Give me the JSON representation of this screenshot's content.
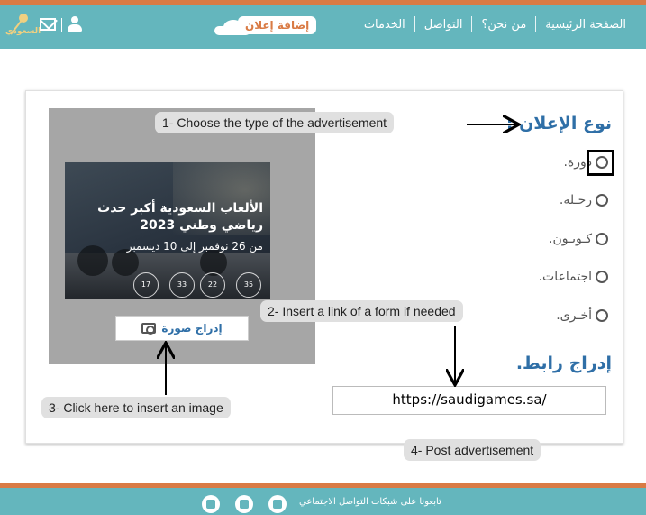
{
  "header": {
    "nav_items": [
      "الصفحة الرئيسية",
      "من نحن؟",
      "التواصل",
      "الخدمات"
    ],
    "add_ad_label": "إضافة إعلان",
    "logo_text": "السعودي"
  },
  "form": {
    "ad_type_title": "نوع الإعلان :",
    "options": [
      "دورة.",
      "رحـلة.",
      "كـوبـون.",
      "اجتماعات.",
      "أخـرى."
    ],
    "insert_link_title": "إدراج رابط.",
    "link_value": "https://saudigames.sa/",
    "insert_image_label": "إدراج صورة"
  },
  "image": {
    "title": "الألعاب السعودية أكبر حدث رياضي وطني 2023",
    "subtitle": "من 26 نوفمبر إلى 10 ديسمبر",
    "countdown": [
      "17",
      "33",
      "22",
      "35"
    ]
  },
  "annotations": {
    "step1": "1- Choose the type of the advertisement",
    "step2": "2- Insert a link of a form if needed",
    "step3": "3- Click here to insert an image",
    "step4": "4- Post advertisement"
  },
  "footer": {
    "text": "تابعونا على شبكات التواصل الاجتماعي"
  },
  "colors": {
    "header": "#64b6bd",
    "accent": "#d97b45",
    "title_blue": "#2f6fa7"
  }
}
